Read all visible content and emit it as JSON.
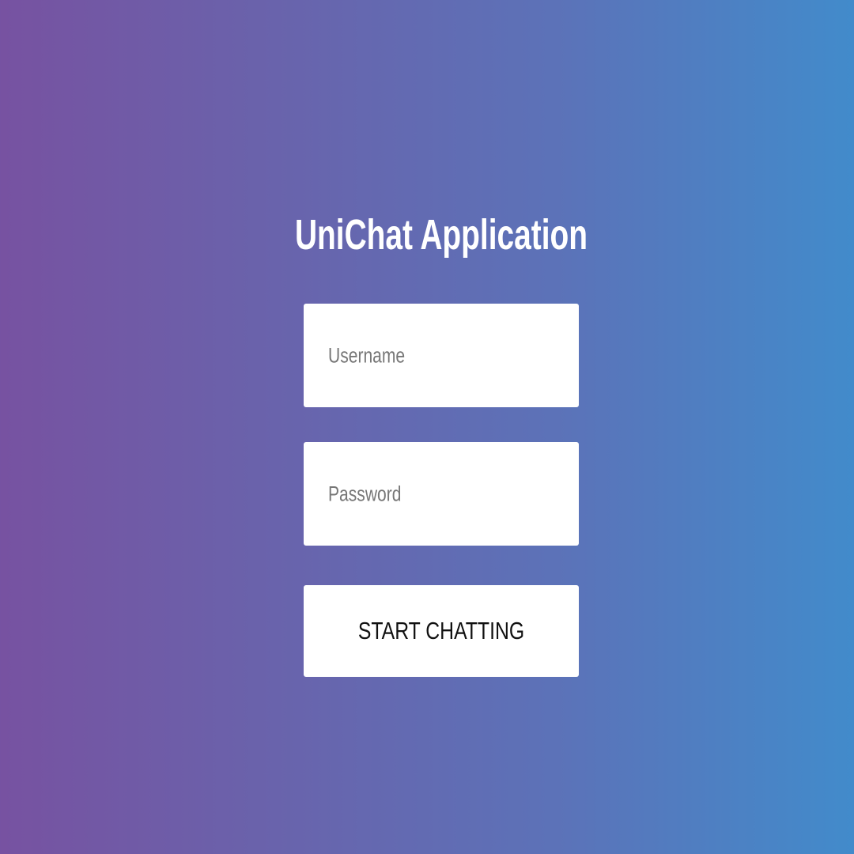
{
  "title": "UniChat Application",
  "form": {
    "username_placeholder": "Username",
    "password_placeholder": "Password",
    "submit_label": "START CHATTING"
  },
  "colors": {
    "gradient_start": "#7752a1",
    "gradient_end": "#428bcb"
  }
}
